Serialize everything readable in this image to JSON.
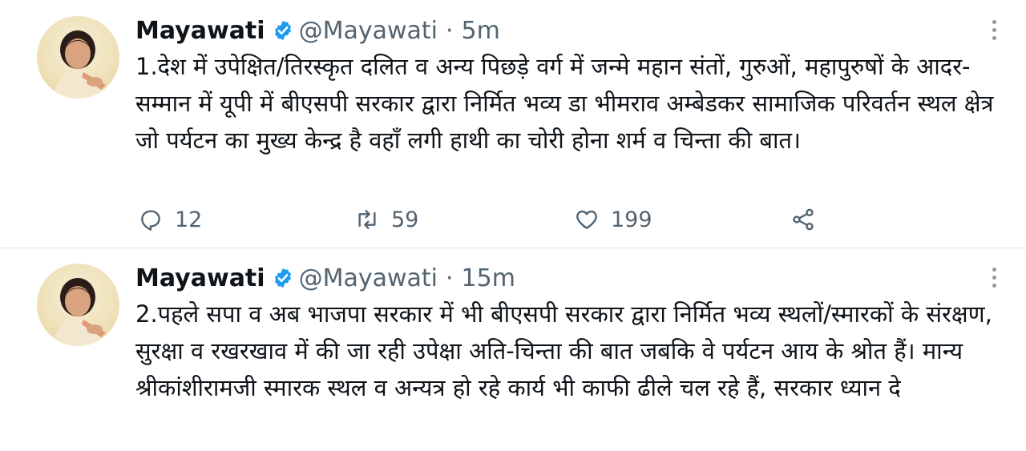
{
  "tweets": [
    {
      "author_name": "Mayawati",
      "handle": "@Mayawati",
      "separator": "·",
      "time": "5m",
      "text": "1.देश में उपेक्षित/तिरस्कृत दलित व अन्य पिछड़े वर्ग में जन्मे महान संतों, गुरुओं, महापुरुषों के आदर-सम्मान में यूपी में बीएसपी सरकार द्वारा निर्मित भव्य डा भीमराव अम्बेडकर सामाजिक परिवर्तन स्थल क्षेत्र जो पर्यटन का मुख्य केन्द्र है वहाँ लगी हाथी का चोरी होना शर्म व चिन्ता की बात।",
      "reply_count": "12",
      "retweet_count": "59",
      "like_count": "199"
    },
    {
      "author_name": "Mayawati",
      "handle": "@Mayawati",
      "separator": "·",
      "time": "15m",
      "text": "2.पहले सपा व अब भाजपा सरकार में भी बीएसपी सरकार द्वारा निर्मित भव्य स्थलों/स्मारकों के संरक्षण, सुरक्षा व रखरखाव में की जा रही उपेक्षा अति-चिन्ता की बात जबकि वे पर्यटन आय के श्रोत हैं। मान्य श्रीकांशीरामजी स्मारक स्थल व अन्यत्र हो रहे कार्य भी काफी ढीले चल रहे हैं, सरकार ध्यान दे"
    }
  ],
  "icons": {
    "verified": "verified-badge-icon",
    "more": "more-options-icon",
    "reply": "reply-icon",
    "retweet": "retweet-icon",
    "like": "heart-icon",
    "share": "share-icon"
  },
  "colors": {
    "verified_blue": "#1d9bf0",
    "text": "#0f1419",
    "secondary": "#536471",
    "divider": "#e3e7ea"
  }
}
